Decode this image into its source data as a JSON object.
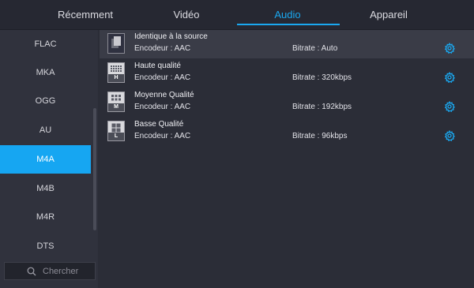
{
  "tabs": [
    {
      "label": "Récemment"
    },
    {
      "label": "Vidéo"
    },
    {
      "label": "Audio",
      "active": true
    },
    {
      "label": "Appareil"
    }
  ],
  "formats": [
    {
      "label": "FLAC"
    },
    {
      "label": "MKA"
    },
    {
      "label": "OGG"
    },
    {
      "label": "AU"
    },
    {
      "label": "M4A",
      "active": true
    },
    {
      "label": "M4B"
    },
    {
      "label": "M4R"
    },
    {
      "label": "DTS"
    }
  ],
  "search": {
    "placeholder": "Chercher"
  },
  "presets": [
    {
      "title": "Identique à la source",
      "encoder": "Encodeur : AAC",
      "bitrate": "Bitrate : Auto",
      "badge": ""
    },
    {
      "title": "Haute qualité",
      "encoder": "Encodeur : AAC",
      "bitrate": "Bitrate : 320kbps",
      "badge": "H"
    },
    {
      "title": "Moyenne Qualité",
      "encoder": "Encodeur : AAC",
      "bitrate": "Bitrate : 192kbps",
      "badge": "M"
    },
    {
      "title": "Basse Qualité",
      "encoder": "Encodeur : AAC",
      "bitrate": "Bitrate : 96kbps",
      "badge": "L"
    }
  ],
  "colors": {
    "accent": "#1aa8f0",
    "background": "#2b2d37",
    "sidebar": "#30323d"
  }
}
